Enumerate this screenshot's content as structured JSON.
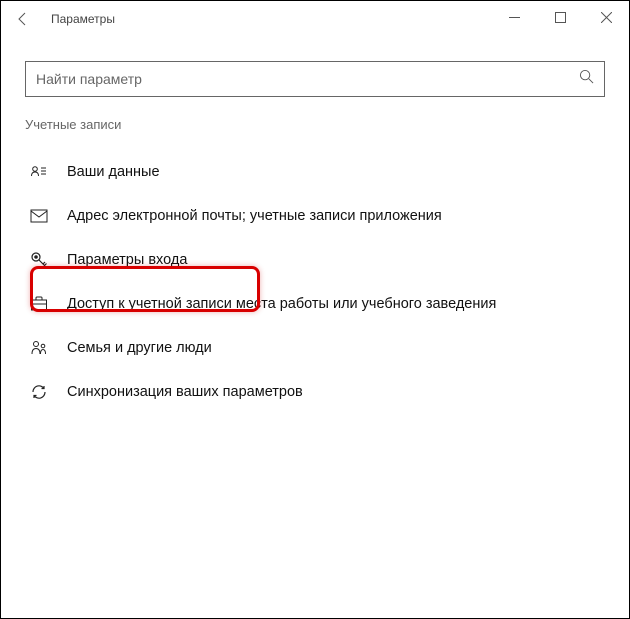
{
  "titlebar": {
    "title": "Параметры"
  },
  "search": {
    "placeholder": "Найти параметр"
  },
  "section": "Учетные записи",
  "items": [
    {
      "label": "Ваши данные"
    },
    {
      "label": "Адрес электронной почты; учетные записи приложения"
    },
    {
      "label": "Параметры входа"
    },
    {
      "label": "Доступ к учетной записи места работы или учебного заведения"
    },
    {
      "label": "Семья и другие люди"
    },
    {
      "label": "Синхронизация ваших параметров"
    }
  ]
}
